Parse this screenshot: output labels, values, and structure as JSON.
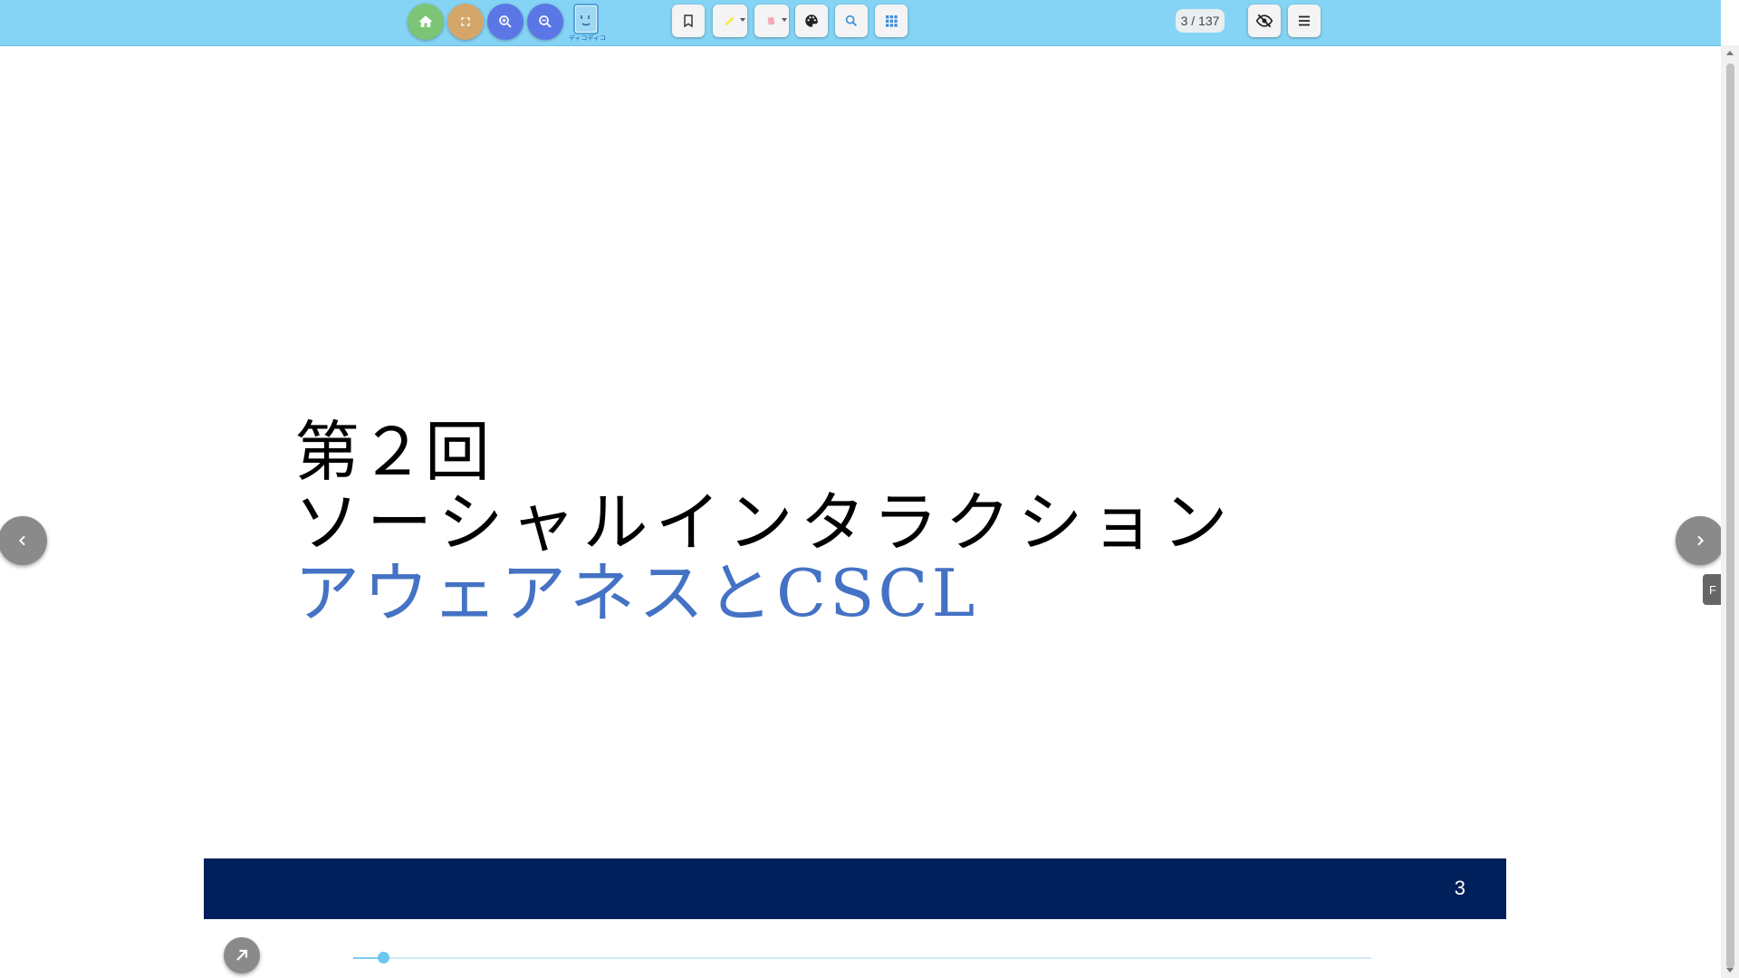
{
  "toolbar": {
    "home_color": "#7cc576",
    "fullscreen_color": "#d4a66a",
    "zoom_in_color": "#5b77e6",
    "zoom_out_color": "#5b77e6",
    "logo_caption": "ディコディコ",
    "highlighter_color": "#f2ea52",
    "eraser_color": "#f4a9b8",
    "search_icon_color": "#3b8de0",
    "grid_icon_color": "#3b8de0",
    "page_indicator": "3 / 137"
  },
  "slide": {
    "title_line1": "第２回",
    "title_line2": "ソーシャルインタラクション",
    "title_line3": "アウェアネスとCSCL",
    "line3_color": "#4472c4",
    "footer_color": "#00205b",
    "page_number": "3"
  },
  "side_tab_label": "F",
  "progress": {
    "current_page": 3,
    "total_pages": 137
  },
  "icons": {
    "home": "home-icon",
    "fullscreen": "fullscreen-icon",
    "zoom_in": "zoom-in-icon",
    "zoom_out": "zoom-out-icon",
    "bookmark": "bookmark-icon",
    "highlighter": "highlighter-icon",
    "eraser": "eraser-icon",
    "palette": "palette-icon",
    "search": "search-icon",
    "grid": "grid-icon",
    "hide": "eye-off-icon",
    "menu": "menu-icon",
    "prev": "chevron-left-icon",
    "next": "chevron-right-icon",
    "expand": "arrow-up-right-icon"
  }
}
